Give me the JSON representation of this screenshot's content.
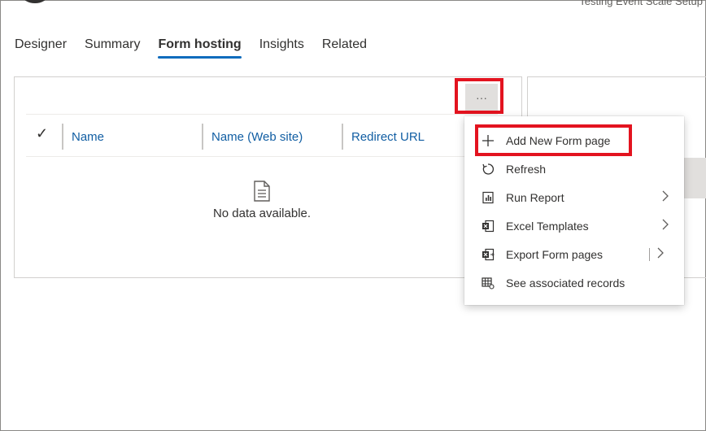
{
  "header": {
    "cut_text": "Testing Event Scale Setup"
  },
  "tabs": [
    {
      "label": "Designer",
      "active": false
    },
    {
      "label": "Summary",
      "active": false
    },
    {
      "label": "Form hosting",
      "active": true
    },
    {
      "label": "Insights",
      "active": false
    },
    {
      "label": "Related",
      "active": false
    }
  ],
  "toolbar": {
    "more_label": "···"
  },
  "grid": {
    "columns": [
      "Name",
      "Name (Web site)",
      "Redirect URL"
    ],
    "empty_text": "No data available."
  },
  "menu": {
    "items": [
      {
        "label": "Add New Form page",
        "icon": "plus-icon"
      },
      {
        "label": "Refresh",
        "icon": "refresh-icon"
      },
      {
        "label": "Run Report",
        "icon": "report-icon",
        "submenu": true
      },
      {
        "label": "Excel Templates",
        "icon": "excel-icon",
        "submenu": true
      },
      {
        "label": "Export Form pages",
        "icon": "excel-export-icon",
        "submenu": true,
        "split": true
      },
      {
        "label": "See associated records",
        "icon": "associated-records-icon"
      }
    ]
  },
  "colors": {
    "accent": "#0f6cbd",
    "highlight": "#e3131f",
    "link": "#115ea3"
  }
}
